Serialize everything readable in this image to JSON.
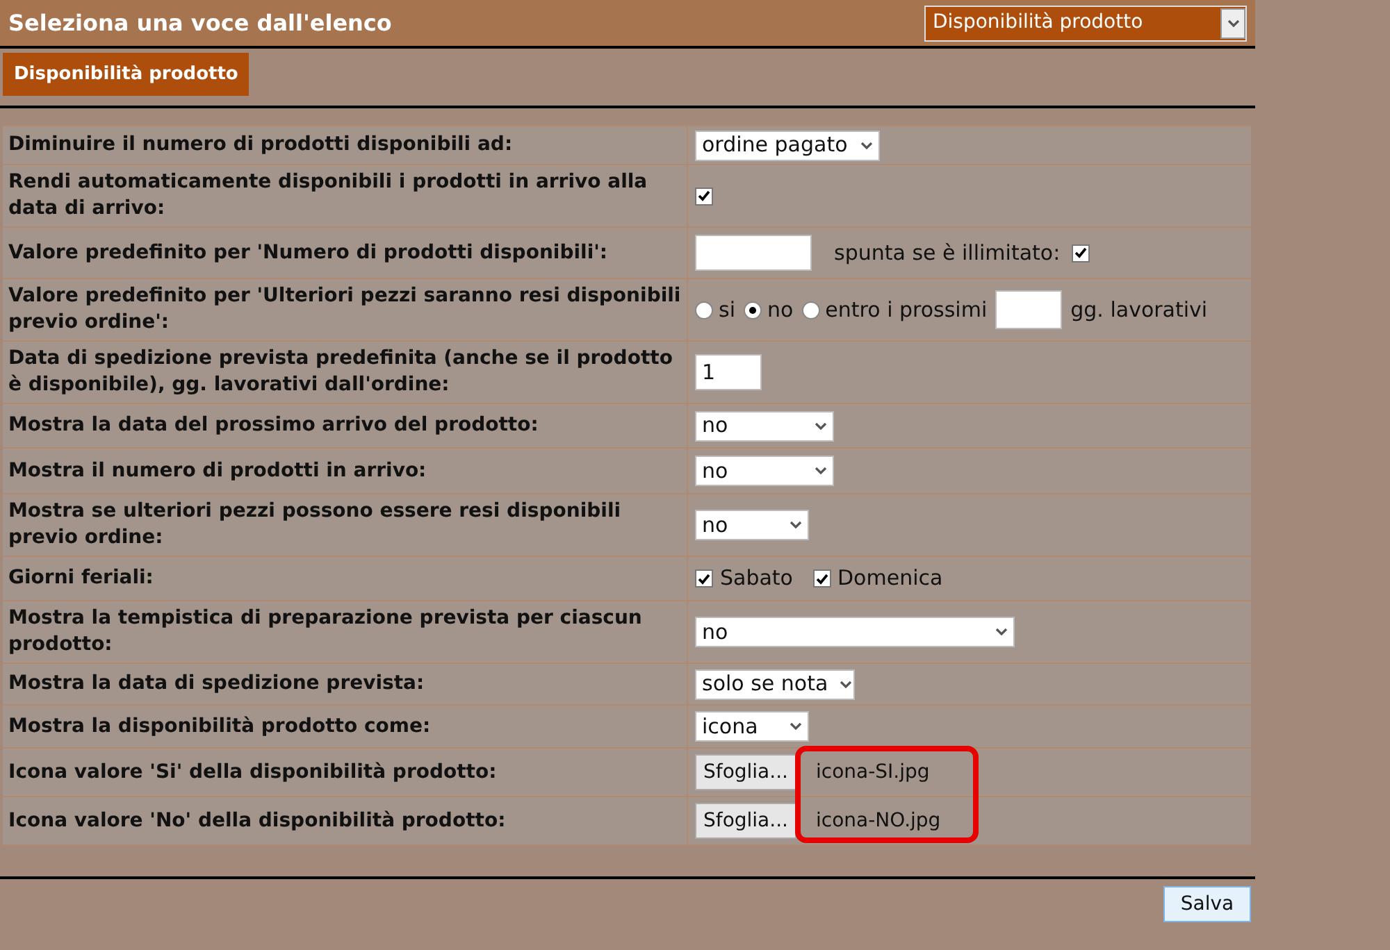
{
  "header": {
    "title": "Seleziona una voce dall'elenco",
    "dropdown": "Disponibilità prodotto"
  },
  "tabs": [
    {
      "label": "Disponibilità prodotto",
      "selected": true
    }
  ],
  "rows": [
    {
      "kind": "select",
      "label": "Diminuire il numero di prodotti disponibili ad:",
      "value": "ordine pagato"
    },
    {
      "kind": "checkbox",
      "label": "Rendi automaticamente disponibili i prodotti in arrivo alla data di arrivo:",
      "checked": true
    },
    {
      "kind": "text_check",
      "label": "Valore predefinito per 'Numero di prodotti disponibili':",
      "check_label": "spunta se è illimitato:",
      "checked": true
    },
    {
      "kind": "radio",
      "label": "Valore predefinito per 'Ulteriori pezzi saranno resi disponibili previo ordine':",
      "options": [
        {
          "label": "si",
          "selected": false
        },
        {
          "label": "no",
          "selected": true
        },
        {
          "label": "entro i prossimi",
          "selected": false
        }
      ],
      "suffix": "gg. lavorativi"
    },
    {
      "kind": "text",
      "label": "Data di spedizione prevista predefinita (anche se il prodotto è disponibile), gg. lavorativi dall'ordine:",
      "value": "1"
    },
    {
      "kind": "select",
      "label": "Mostra la data del prossimo arrivo del prodotto:",
      "value": "no"
    },
    {
      "kind": "select",
      "label": "Mostra il numero di prodotti in arrivo:",
      "value": "no"
    },
    {
      "kind": "select",
      "label": "Mostra se ulteriori pezzi possono essere resi disponibili previo ordine:",
      "value": "no"
    },
    {
      "kind": "checkboxes",
      "label": "Giorni feriali:",
      "options": [
        {
          "label": "Sabato",
          "checked": true
        },
        {
          "label": "Domenica",
          "checked": true
        }
      ]
    },
    {
      "kind": "select",
      "label": "Mostra la tempistica di preparazione prevista per ciascun prodotto:",
      "value": "no"
    },
    {
      "kind": "select",
      "label": "Mostra la data di spedizione prevista:",
      "value": "solo se nota"
    },
    {
      "kind": "select",
      "label": "Mostra la disponibilità prodotto come:",
      "value": "icona"
    },
    {
      "kind": "file",
      "label": "Icona valore 'Si' della disponibilità prodotto:",
      "button": "Sfoglia...",
      "filename": "icona-SI.jpg"
    },
    {
      "kind": "file",
      "label": "Icona valore 'No' della disponibilità prodotto:",
      "button": "Sfoglia...",
      "filename": "icona-NO.jpg"
    }
  ],
  "save_button": "Salva"
}
